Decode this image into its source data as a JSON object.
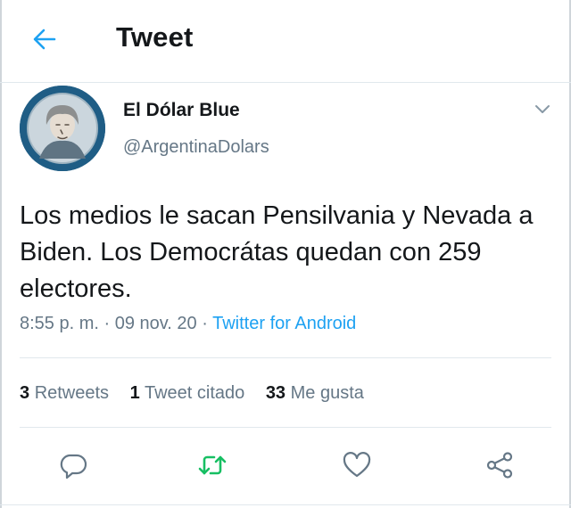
{
  "header": {
    "title": "Tweet",
    "back_icon": "arrow-left-icon"
  },
  "user": {
    "display_name": "El Dólar Blue",
    "handle": "@ArgentinaDolars",
    "avatar_icon": "banknote-portrait-avatar"
  },
  "tweet": {
    "text": "Los medios le sacan Pensilvania y Nevada a Biden. Los Democrátas quedan con 259 electores.",
    "time": "8:55 p. m.",
    "separator": "·",
    "date": "09 nov. 20",
    "source": "Twitter for Android"
  },
  "stats": {
    "retweets_count": "3",
    "retweets_label": "Retweets",
    "quotes_count": "1",
    "quotes_label": "Tweet citado",
    "likes_count": "33",
    "likes_label": "Me gusta"
  },
  "actions": {
    "reply_icon": "reply-icon",
    "retweet_icon": "retweet-icon",
    "like_icon": "heart-icon",
    "share_icon": "share-icon"
  },
  "colors": {
    "accent": "#1da1f2",
    "retweet": "#17bf63",
    "text": "#14171a",
    "muted": "#657786",
    "avatar_bg": "#1f5d85"
  }
}
